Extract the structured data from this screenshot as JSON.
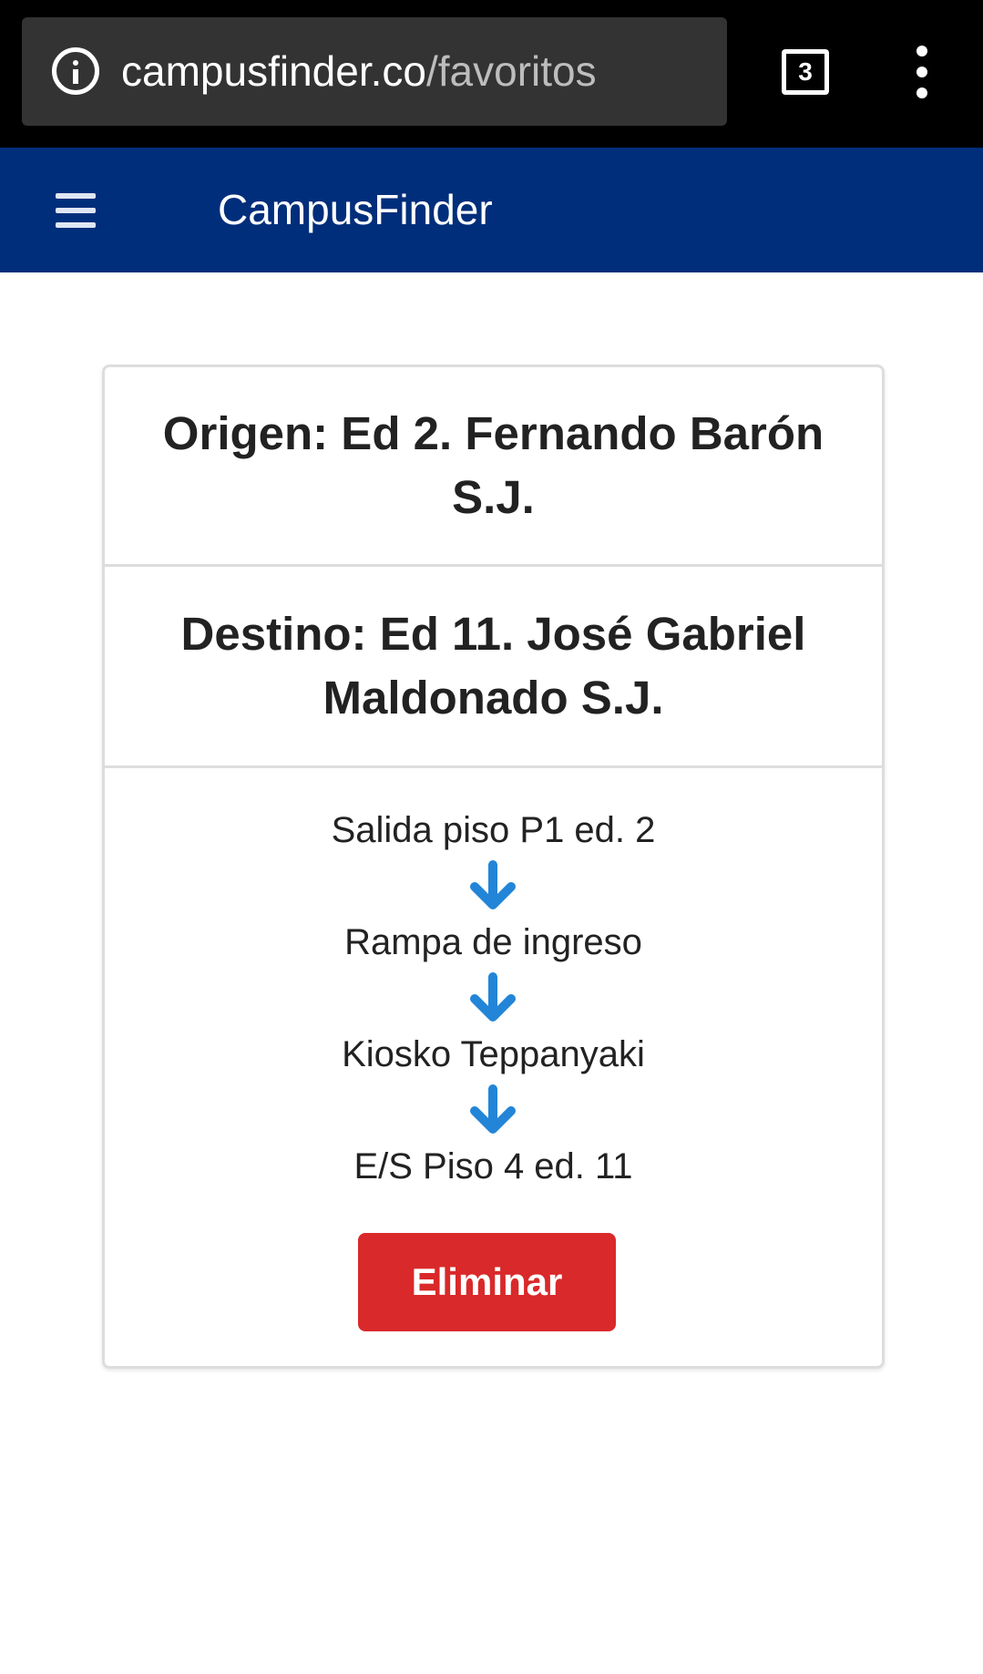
{
  "browser": {
    "url_host": "campusfinder.co",
    "url_path": "/favoritos",
    "tab_count": "3"
  },
  "header": {
    "title": "CampusFinder"
  },
  "favorite": {
    "origin": "Origen: Ed 2. Fernando Barón S.J.",
    "destination": "Destino: Ed 11. José Gabriel Maldonado S.J.",
    "steps": [
      "Salida piso P1 ed. 2",
      "Rampa de ingreso",
      "Kiosko Teppanyaki",
      "E/S Piso 4 ed. 11"
    ],
    "delete_label": "Eliminar"
  },
  "icons": {
    "info": "info-icon",
    "tabs": "tabs-icon",
    "menu": "more-vert-icon",
    "hamburger": "hamburger-menu-icon",
    "step_arrow": "arrow-down-icon"
  },
  "colors": {
    "header_bg": "#002e7b",
    "browser_bg": "#000000",
    "url_box_bg": "#333333",
    "arrow": "#2385d7",
    "delete_button": "#d9292a"
  }
}
